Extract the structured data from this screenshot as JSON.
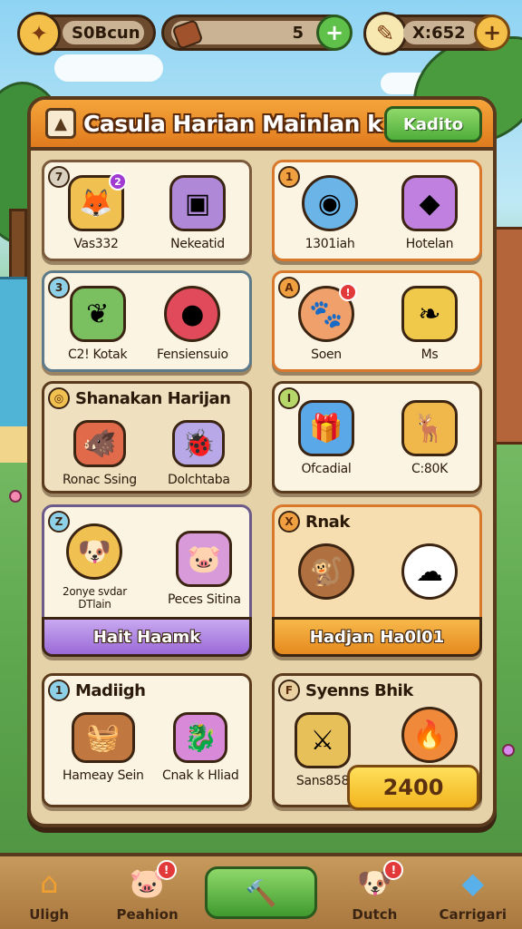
{
  "resources": {
    "food": {
      "value": "S0Bcun",
      "icon": "ginger-root-icon"
    },
    "wood": {
      "value": "5",
      "icon": "log-icon"
    },
    "gems": {
      "value": "X:652",
      "icon": "brush-icon"
    }
  },
  "panel": {
    "title": "Casula Harian Mainlan k",
    "header_button": "Kadito"
  },
  "cards": [
    {
      "badge": "7",
      "title": "",
      "items": [
        {
          "label": "Vas332",
          "icon": "fox-on-box",
          "notif": "2"
        },
        {
          "label": "Nekeatid",
          "icon": "purple-box",
          "notif": ""
        }
      ]
    },
    {
      "badge": "1",
      "title": "",
      "items": [
        {
          "label": "1301iah",
          "icon": "blue-orb",
          "notif": ""
        },
        {
          "label": "Hotelan",
          "icon": "purple-gift",
          "notif": ""
        }
      ]
    },
    {
      "badge": "3",
      "title": "",
      "items": [
        {
          "label": "C2! Kotak",
          "icon": "green-fruit",
          "notif": ""
        },
        {
          "label": "Fensiensuio",
          "icon": "red-ball",
          "notif": ""
        }
      ]
    },
    {
      "badge": "A",
      "title": "",
      "items": [
        {
          "label": "Soen",
          "icon": "critter",
          "notif": "!"
        },
        {
          "label": "Ms",
          "icon": "gold-leaf",
          "notif": ""
        }
      ]
    },
    {
      "badge": "",
      "title": "Shanakan Harijan",
      "items": [
        {
          "label": "Ronac Ssing",
          "icon": "red-beast",
          "notif": ""
        },
        {
          "label": "Dolchtaba",
          "icon": "bugs",
          "notif": ""
        }
      ]
    },
    {
      "badge": "I",
      "title": "",
      "items": [
        {
          "label": "Ofcadial",
          "icon": "blue-gift",
          "notif": ""
        },
        {
          "label": "C:80K",
          "icon": "golden-deer",
          "notif": ""
        }
      ]
    },
    {
      "badge": "Z",
      "title": "",
      "items": [
        {
          "label": "2onye svdar\nDTlain",
          "icon": "yellow-dog",
          "notif": ""
        },
        {
          "label": "Peces Sitina",
          "icon": "purple-pig",
          "notif": ""
        }
      ],
      "button": "Hait  Haamk"
    },
    {
      "badge": "X",
      "title": "Rnak",
      "items": [
        {
          "label": "",
          "icon": "monkey",
          "notif": ""
        },
        {
          "label": "",
          "icon": "white-cloud-creature",
          "notif": ""
        }
      ],
      "button": "Hadjan  Ha0l01"
    },
    {
      "badge": "1",
      "title": "Madiigh",
      "items": [
        {
          "label": "Hameay Sein",
          "icon": "treasure-basket",
          "notif": ""
        },
        {
          "label": "Cnak k Hliad",
          "icon": "purple-dragon",
          "notif": ""
        }
      ]
    },
    {
      "badge": "F",
      "title": "Syenns Bhik",
      "items": [
        {
          "label": "Sans858",
          "icon": "gold-sword",
          "notif": ""
        },
        {
          "label": "",
          "icon": "fire-bird",
          "notif": ""
        }
      ],
      "price": "2400"
    }
  ],
  "nav": [
    {
      "label": "Uligh",
      "icon": "home-icon",
      "notif": ""
    },
    {
      "label": "Peahion",
      "icon": "pet-icon",
      "notif": "!"
    },
    {
      "label": "",
      "icon": "hammer-icon",
      "notif": ""
    },
    {
      "label": "Dutch",
      "icon": "dog-face-icon",
      "notif": "!"
    },
    {
      "label": "Carrigari",
      "icon": "crystal-icon",
      "notif": ""
    }
  ]
}
